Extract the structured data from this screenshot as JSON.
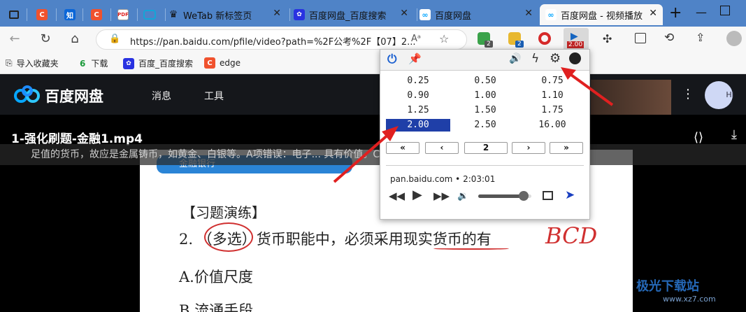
{
  "tabs": [
    {
      "label": "",
      "icon": "tab-page-icon"
    },
    {
      "label": "",
      "icon": "c-icon"
    },
    {
      "label": "",
      "icon": "zhihu-icon"
    },
    {
      "label": "",
      "icon": "c-icon"
    },
    {
      "label": "",
      "icon": "pdf-icon"
    },
    {
      "label": "",
      "icon": "bilibili-icon"
    },
    {
      "label": "WeTab 新标签页",
      "icon": "wetab-icon"
    },
    {
      "label": "百度网盘_百度搜索",
      "icon": "baidu-paw-icon"
    },
    {
      "label": "百度网盘",
      "icon": "baidupan-icon"
    },
    {
      "label": "百度网盘 - 视频播放",
      "icon": "baidupan-icon",
      "active": true
    }
  ],
  "zhihu_glyph": "知",
  "pdf_glyph": "PDF",
  "address": {
    "url": "https://pan.baidu.com/pfile/video?path=%2F公考%2F【07】2..."
  },
  "badges": {
    "ext1": "2",
    "ext2": "2",
    "speed_badge": "2.00"
  },
  "bookmarks": [
    {
      "label": "导入收藏夹"
    },
    {
      "label": "下载"
    },
    {
      "label": "百度_百度搜索"
    },
    {
      "label": "edge"
    }
  ],
  "pan": {
    "logo_text": "百度网盘",
    "nav": [
      "消息",
      "工具"
    ],
    "video_title": "1-强化刷题-金融1.mp4",
    "subtitle": "足值的货币，故应是金属铸币，如黄金、白银等。A项错误：电子...                                                      具有价值。C、D项错误：纸币的",
    "avatar_text": "Hi"
  },
  "doc": {
    "bank_label": "金融银行",
    "heading": "【习题演练】",
    "question": "2. （多选）货币职能中，必须采用现实货币的有",
    "answer": "BCD",
    "option_a": "A.价值尺度",
    "option_b": "B.流通手段"
  },
  "popup": {
    "speeds": [
      [
        "0.25",
        "0.50",
        "0.75"
      ],
      [
        "0.90",
        "1.00",
        "1.10"
      ],
      [
        "1.25",
        "1.50",
        "1.75"
      ],
      [
        "2.00",
        "2.50",
        "16.00"
      ]
    ],
    "selected": "2.00",
    "step_value": "2",
    "tab_info": "pan.baidu.com • 2:03:01",
    "volume_level": 0.85
  },
  "watermark": {
    "text": "极光下载站",
    "sub": "www.xz7.com"
  },
  "colors": {
    "tabstrip": "#4f83c7",
    "selected_speed": "#1f3fa8",
    "arrow": "#e02020",
    "pan_header": "#15171b"
  }
}
